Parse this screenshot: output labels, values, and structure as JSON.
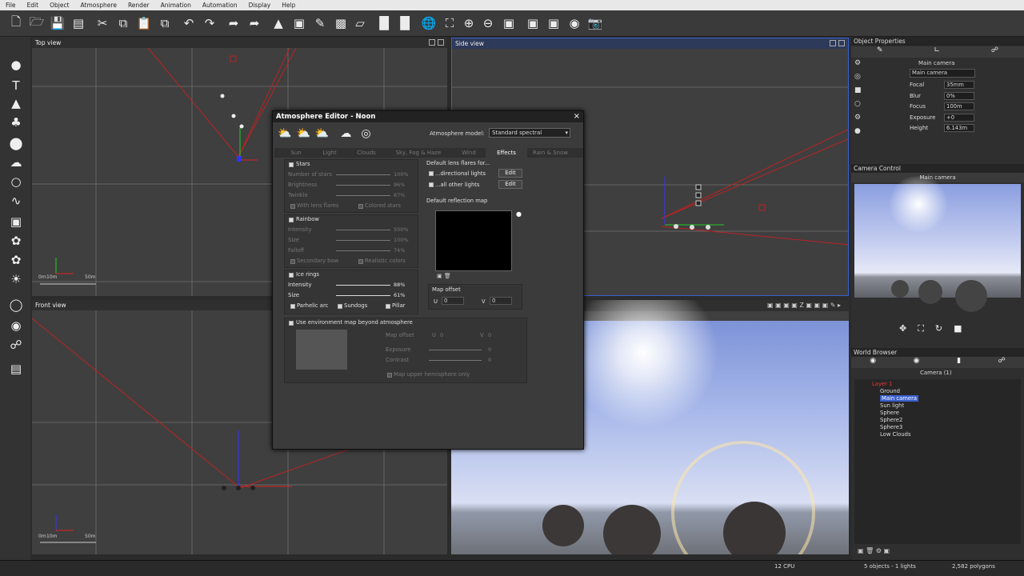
{
  "menu": [
    "File",
    "Edit",
    "Object",
    "Atmosphere",
    "Render",
    "Animation",
    "Automation",
    "Display",
    "Help"
  ],
  "viewports": {
    "top": {
      "title": "Top view",
      "r0": "0m",
      "r1": "10m",
      "r2": "50m"
    },
    "side": {
      "title": "Side view"
    },
    "front": {
      "title": "Front view",
      "r0": "0m",
      "r1": "10m",
      "r2": "50m"
    }
  },
  "dialog": {
    "title": "Atmosphere Editor - Noon",
    "model_label": "Atmosphere model:",
    "model_value": "Standard spectral",
    "tabs": [
      "Sun",
      "Light",
      "Clouds",
      "Sky, Fog & Haze",
      "Wind",
      "Effects",
      "Rain & Snow"
    ],
    "active_tab": "Effects",
    "stars": {
      "label": "Stars",
      "rows": [
        {
          "label": "Number of stars",
          "value": "100%"
        },
        {
          "label": "Brightness",
          "value": "96%"
        },
        {
          "label": "Twinkle",
          "value": "87%"
        }
      ],
      "opt1": "With lens flares",
      "opt2": "Colored stars"
    },
    "rainbow": {
      "label": "Rainbow",
      "rows": [
        {
          "label": "Intensity",
          "value": "500%"
        },
        {
          "label": "Size",
          "value": "100%"
        },
        {
          "label": "Falloff",
          "value": "74%"
        }
      ],
      "opt1": "Secondary bow",
      "opt2": "Realistic colors"
    },
    "ice": {
      "label": "Ice rings",
      "rows": [
        {
          "label": "Intensity",
          "value": "88%"
        },
        {
          "label": "Size",
          "value": "61%"
        }
      ],
      "opt1": "Parhelic arc",
      "opt2": "Sundogs",
      "opt3": "Pillar"
    },
    "env": {
      "label": "Use environment map beyond atmosphere",
      "map_offset": "Map offset",
      "u": "U",
      "v": "V",
      "u_val": "0",
      "v_val": "0",
      "exposure": "Exposure",
      "exposure_val": "0",
      "contrast": "Contrast",
      "contrast_val": "0",
      "upper": "Map upper hemisphere only"
    },
    "flares": {
      "label": "Default lens flares for...",
      "row1": "...directional lights",
      "row2": "...all other lights",
      "edit": "Edit"
    },
    "reflection": {
      "label": "Default reflection map",
      "offset": "Map offset",
      "u": "U",
      "v": "V",
      "u_val": "0",
      "v_val": "0"
    }
  },
  "object_properties": {
    "title": "Object Properties",
    "name": "Main camera",
    "camera_select": "Main camera",
    "rows": [
      {
        "label": "Focal",
        "value": "35mm"
      },
      {
        "label": "Blur",
        "value": "0%"
      },
      {
        "label": "Focus",
        "value": "100m"
      },
      {
        "label": "Exposure",
        "value": "+0"
      },
      {
        "label": "Height",
        "value": "6.143m"
      }
    ]
  },
  "camera_control": {
    "title": "Camera Control",
    "name": "Main camera"
  },
  "world_browser": {
    "title": "World Browser",
    "tab": "Camera (1)",
    "items": [
      "Layer 1",
      "Ground",
      "Main camera",
      "Sun light",
      "Sphere",
      "Sphere2",
      "Sphere3",
      "Low Clouds"
    ]
  },
  "status": {
    "cpu": "12 CPU",
    "objects": "5 objects - 1 lights",
    "polygons": "2,582 polygons"
  },
  "colors": {
    "accent": "#3a5fcd",
    "sky_top": "#8fa6e0",
    "axis_red": "#d22",
    "axis_green": "#2c2",
    "axis_blue": "#33f"
  }
}
